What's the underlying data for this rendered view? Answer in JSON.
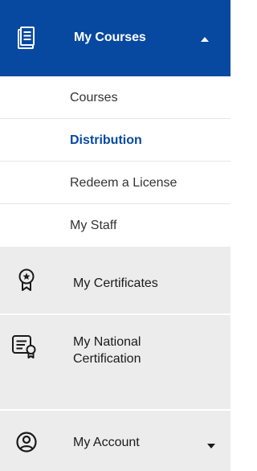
{
  "menu": {
    "active_section": {
      "label": "My Courses",
      "icon": "document-list-icon",
      "expanded": true,
      "caret": "caret-up-icon"
    },
    "submenu": [
      {
        "label": "Courses",
        "current": false
      },
      {
        "label": "Distribution",
        "current": true
      },
      {
        "label": "Redeem a License",
        "current": false
      },
      {
        "label": "My Staff",
        "current": false
      }
    ],
    "items": [
      {
        "label": "My Certificates",
        "icon": "certificate-badge-icon"
      },
      {
        "label_line1": "My National",
        "label_line2": "Certification",
        "icon": "national-certification-icon"
      },
      {
        "label": "My Account",
        "icon": "user-account-icon",
        "caret": "caret-down-icon"
      }
    ]
  },
  "colors": {
    "primary": "#0749a0",
    "item_background": "#ececec",
    "text": "#1a1a1a"
  }
}
